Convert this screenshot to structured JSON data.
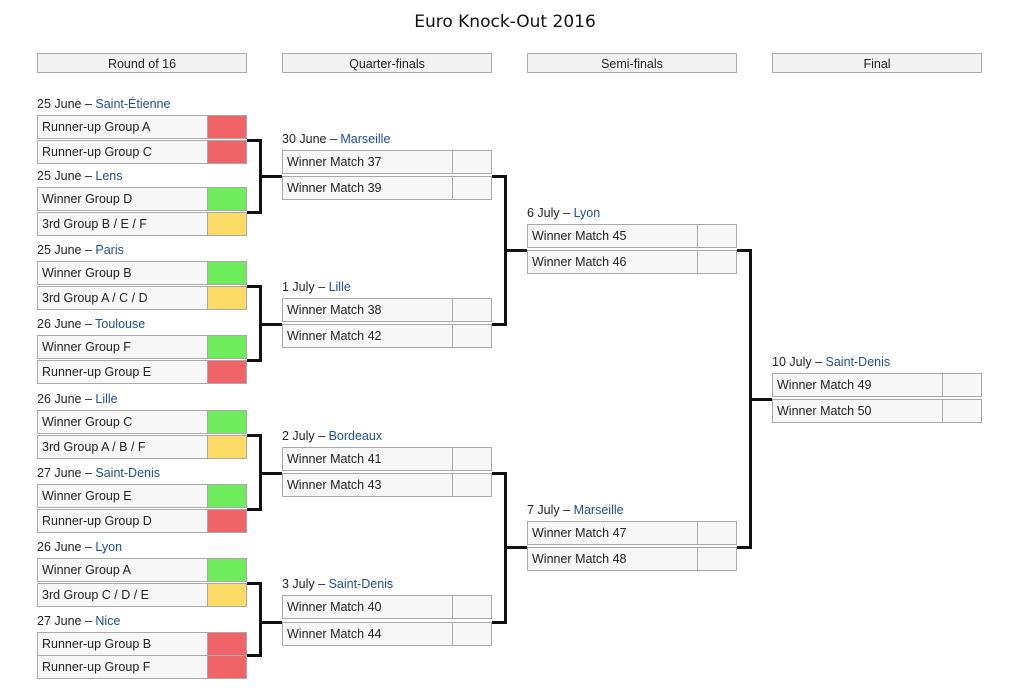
{
  "title": "Euro Knock-Out 2016",
  "rounds": [
    "Round of 16",
    "Quarter-finals",
    "Semi-finals",
    "Final"
  ],
  "colors": {
    "runnerup": "#f06468",
    "winner": "#6eec5c",
    "third": "#fddb67",
    "empty": "#f7f7f7"
  },
  "matches": [
    {
      "round": 0,
      "date": "25 June",
      "venue": "Saint-Étienne",
      "teams": [
        {
          "name": "Runner-up Group A",
          "status": "runnerup"
        },
        {
          "name": "Runner-up Group C",
          "status": "runnerup"
        }
      ]
    },
    {
      "round": 0,
      "date": "25 June",
      "venue": "Lens",
      "teams": [
        {
          "name": "Winner Group D",
          "status": "winner"
        },
        {
          "name": "3rd Group B / E / F",
          "status": "third"
        }
      ]
    },
    {
      "round": 0,
      "date": "25 June",
      "venue": "Paris",
      "teams": [
        {
          "name": "Winner Group B",
          "status": "winner"
        },
        {
          "name": "3rd Group A / C / D",
          "status": "third"
        }
      ]
    },
    {
      "round": 0,
      "date": "26 June",
      "venue": "Toulouse",
      "teams": [
        {
          "name": "Winner Group F",
          "status": "winner"
        },
        {
          "name": "Runner-up Group E",
          "status": "runnerup"
        }
      ]
    },
    {
      "round": 0,
      "date": "26 June",
      "venue": "Lille",
      "teams": [
        {
          "name": "Winner Group C",
          "status": "winner"
        },
        {
          "name": "3rd Group A / B / F",
          "status": "third"
        }
      ]
    },
    {
      "round": 0,
      "date": "27 June",
      "venue": "Saint-Denis",
      "teams": [
        {
          "name": "Winner Group E",
          "status": "winner"
        },
        {
          "name": "Runner-up Group D",
          "status": "runnerup"
        }
      ]
    },
    {
      "round": 0,
      "date": "26 June",
      "venue": "Lyon",
      "teams": [
        {
          "name": "Winner Group A",
          "status": "winner"
        },
        {
          "name": "3rd Group C / D / E",
          "status": "third"
        }
      ]
    },
    {
      "round": 0,
      "date": "27 June",
      "venue": "Nice",
      "teams": [
        {
          "name": "Runner-up Group B",
          "status": "runnerup"
        },
        {
          "name": "Runner-up Group F",
          "status": "runnerup"
        }
      ]
    },
    {
      "round": 1,
      "date": "30 June",
      "venue": "Marseille",
      "teams": [
        {
          "name": "Winner Match 37",
          "status": "empty"
        },
        {
          "name": "Winner Match 39",
          "status": "empty"
        }
      ]
    },
    {
      "round": 1,
      "date": "1 July",
      "venue": "Lille",
      "teams": [
        {
          "name": "Winner Match 38",
          "status": "empty"
        },
        {
          "name": "Winner Match 42",
          "status": "empty"
        }
      ]
    },
    {
      "round": 1,
      "date": "2 July",
      "venue": "Bordeaux",
      "teams": [
        {
          "name": "Winner Match 41",
          "status": "empty"
        },
        {
          "name": "Winner Match 43",
          "status": "empty"
        }
      ]
    },
    {
      "round": 1,
      "date": "3 July",
      "venue": "Saint-Denis",
      "teams": [
        {
          "name": "Winner Match 40",
          "status": "empty"
        },
        {
          "name": "Winner Match 44",
          "status": "empty"
        }
      ]
    },
    {
      "round": 2,
      "date": "6 July",
      "venue": "Lyon",
      "teams": [
        {
          "name": "Winner Match 45",
          "status": "empty"
        },
        {
          "name": "Winner Match 46",
          "status": "empty"
        }
      ]
    },
    {
      "round": 2,
      "date": "7 July",
      "venue": "Marseille",
      "teams": [
        {
          "name": "Winner Match 47",
          "status": "empty"
        },
        {
          "name": "Winner Match 48",
          "status": "empty"
        }
      ]
    },
    {
      "round": 3,
      "date": "10 July",
      "venue": "Saint-Denis",
      "teams": [
        {
          "name": "Winner Match 49",
          "status": "empty"
        },
        {
          "name": "Winner Match 50",
          "status": "empty"
        }
      ]
    }
  ]
}
